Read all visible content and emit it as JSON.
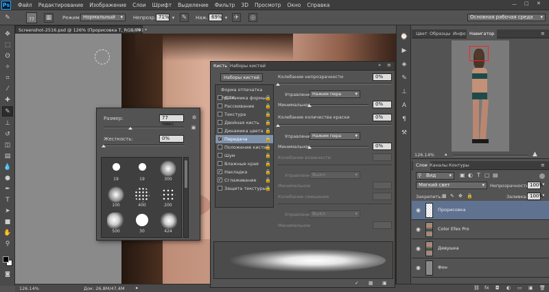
{
  "app": {
    "logo": "Ps",
    "accent": "#31a8ff"
  },
  "menu": [
    "Файл",
    "Редактирование",
    "Изображение",
    "Слои",
    "Шрифт",
    "Выделение",
    "Фильтр",
    "3D",
    "Просмотр",
    "Окно",
    "Справка"
  ],
  "window_controls": {
    "minimize": "—",
    "maximize": "□",
    "close": "✕"
  },
  "options": {
    "brush_size": "77",
    "mode_label": "Режим:",
    "mode_value": "Нормальный",
    "opacity_label": "Непрозр.:",
    "opacity_value": "71%",
    "pressure_label": "Наж.:",
    "pressure_value": "69%",
    "workspace": "Основная рабочая среда"
  },
  "document": {
    "tab_title": "Screenshot-2516.psd @ 126% (Прорисовка Т, RGB/8#) *",
    "tab_close": "×",
    "zoom": "126.14%",
    "doc_info": "Док: 26,8M/47,4M"
  },
  "brush_picker": {
    "size_label": "Размер:",
    "size_value": "77 пикс.",
    "size_fraction": 0.33,
    "hardness_label": "Жесткость:",
    "hardness_value": "0%",
    "hardness_fraction": 0.0,
    "presets": [
      {
        "size": "19",
        "kind": "hard"
      },
      {
        "size": "19",
        "kind": "hard"
      },
      {
        "size": "300",
        "kind": "soft"
      },
      {
        "size": "100",
        "kind": "soft"
      },
      {
        "size": "400",
        "kind": "spatter"
      },
      {
        "size": "200",
        "kind": "spatter"
      },
      {
        "size": "500",
        "kind": "cloud"
      },
      {
        "size": "30",
        "kind": "hard"
      },
      {
        "size": "424",
        "kind": "cloud"
      }
    ]
  },
  "brush_panel": {
    "tab_brush": "Кисть",
    "tab_presets": "Наборы кистей",
    "presets_button": "Наборы кистей",
    "tip_shape_label": "Форма отпечатка кисти",
    "options": [
      {
        "label": "Динамика формы",
        "checked": false
      },
      {
        "label": "Рассеивание",
        "checked": false
      },
      {
        "label": "Текстура",
        "checked": false
      },
      {
        "label": "Двойная кисть",
        "checked": false
      },
      {
        "label": "Динамика цвета",
        "checked": false
      },
      {
        "label": "Передача",
        "checked": true,
        "selected": true
      },
      {
        "label": "Положение кисти",
        "checked": false
      },
      {
        "label": "Шум",
        "checked": false
      },
      {
        "label": "Влажные края",
        "checked": false
      },
      {
        "label": "Накладка",
        "checked": true
      },
      {
        "label": "Сглаживание",
        "checked": true
      },
      {
        "label": "Защита текстуры",
        "checked": false
      }
    ],
    "opacity_jitter_label": "Колебание непрозрачности",
    "opacity_jitter_value": "0%",
    "control_label": "Управление:",
    "pen_pressure": "Нажим пера",
    "minimum_label": "Минимальное",
    "min_opacity_value": "0%",
    "flow_jitter_label": "Колебание количества краски",
    "flow_jitter_value": "0%",
    "min_flow_value": "0%",
    "wetness_jitter_label": "Колебание влажности",
    "off_value": "Выкл",
    "mix_jitter_label": "Колебание смешения"
  },
  "navigator": {
    "tabs": [
      "Цвет",
      "Образцы",
      "Инфо",
      "Навигатор"
    ],
    "zoom": "126.14%"
  },
  "layers_panel": {
    "tabs": [
      "Слои",
      "Каналы",
      "Контуры"
    ],
    "kind_value": "Вид",
    "blend_mode": "Мягкий свет",
    "opacity_label": "Непрозрачность:",
    "opacity_value": "100%",
    "lock_label": "Закрепить:",
    "fill_label": "Заливка:",
    "fill_value": "100%",
    "layers": [
      {
        "name": "Прорисовка",
        "selected": true
      },
      {
        "name": "Color Efex Pro",
        "selected": false
      },
      {
        "name": "Девушка",
        "selected": false
      },
      {
        "name": "Фон",
        "selected": false
      }
    ],
    "footer_icons": [
      "link-icon",
      "fx-icon",
      "mask-icon",
      "adjustment-icon",
      "folder-icon",
      "new-layer-icon",
      "trash-icon"
    ]
  }
}
